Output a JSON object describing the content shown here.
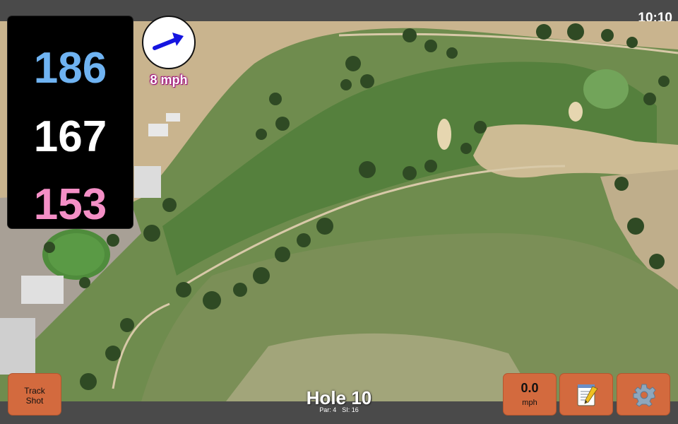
{
  "status_bar": {
    "time": "10:10"
  },
  "distances": {
    "back": "186",
    "middle": "167",
    "front": "153"
  },
  "wind": {
    "speed_label": "8 mph",
    "direction_icon": "arrow-right-icon"
  },
  "hole": {
    "title": "Hole 10",
    "par_label": "Par: 4",
    "si_label": "SI: 16"
  },
  "buttons": {
    "track_shot_line1": "Track",
    "track_shot_line2": "Shot",
    "speed_value": "0.0",
    "speed_unit": "mph",
    "notes_icon": "notepad-icon",
    "settings_icon": "gear-icon"
  },
  "colors": {
    "accent_button": "#d36a3e",
    "back_distance": "#6fb3f2",
    "middle_distance": "#ffffff",
    "front_distance": "#f48fc6",
    "wind_arrow": "#1515e0"
  }
}
